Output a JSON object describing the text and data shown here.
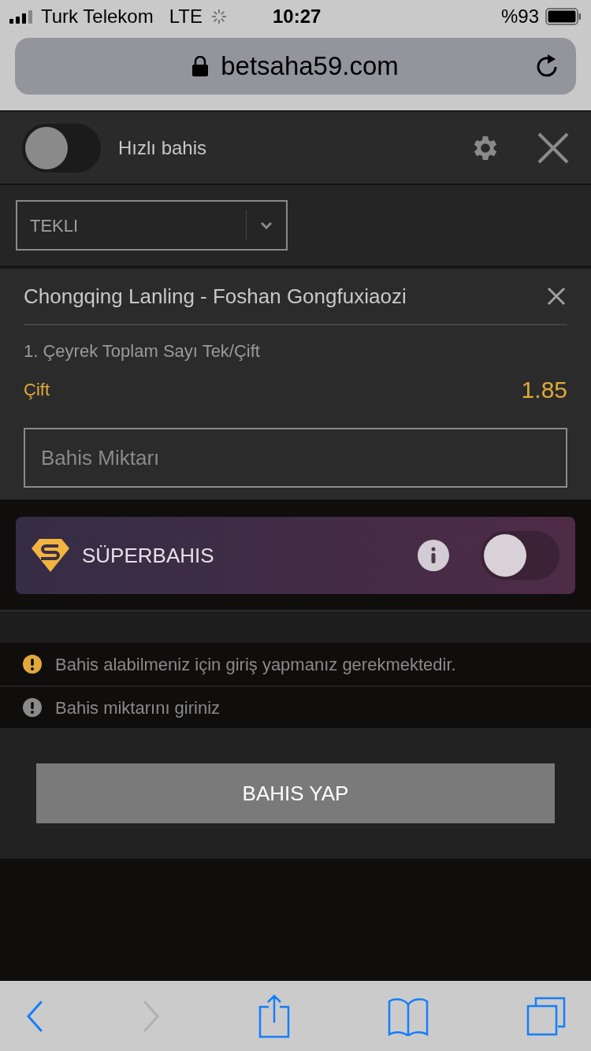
{
  "status_bar": {
    "carrier": "Turk Telekom",
    "network": "LTE",
    "time": "10:27",
    "battery": "%93"
  },
  "address_bar": {
    "url": "betsaha59.com"
  },
  "header": {
    "quick_bet": {
      "label": "Hızlı bahis",
      "on": false
    }
  },
  "bet_type": {
    "value": "TEKLI"
  },
  "selection": {
    "match": "Chongqing Lanling - Foshan Gongfuxiaozi",
    "market": "1. Çeyrek Toplam Sayı Tek/Çift",
    "pick": "Çift",
    "odds": "1.85",
    "stake": {
      "placeholder": "Bahis Miktarı"
    }
  },
  "superbahis": {
    "label": "SÜPERBAHIS",
    "on": false
  },
  "messages": [
    {
      "kind": "warning",
      "text": "Bahis alabilmeniz için giriş yapmanız gerekmektedir."
    },
    {
      "kind": "error",
      "text": "Bahis miktarını giriniz"
    }
  ],
  "place_bet": {
    "label": "BAHIS YAP"
  },
  "toolbar": {
    "back": {
      "disabled": false
    },
    "forward": {
      "disabled": true
    }
  }
}
